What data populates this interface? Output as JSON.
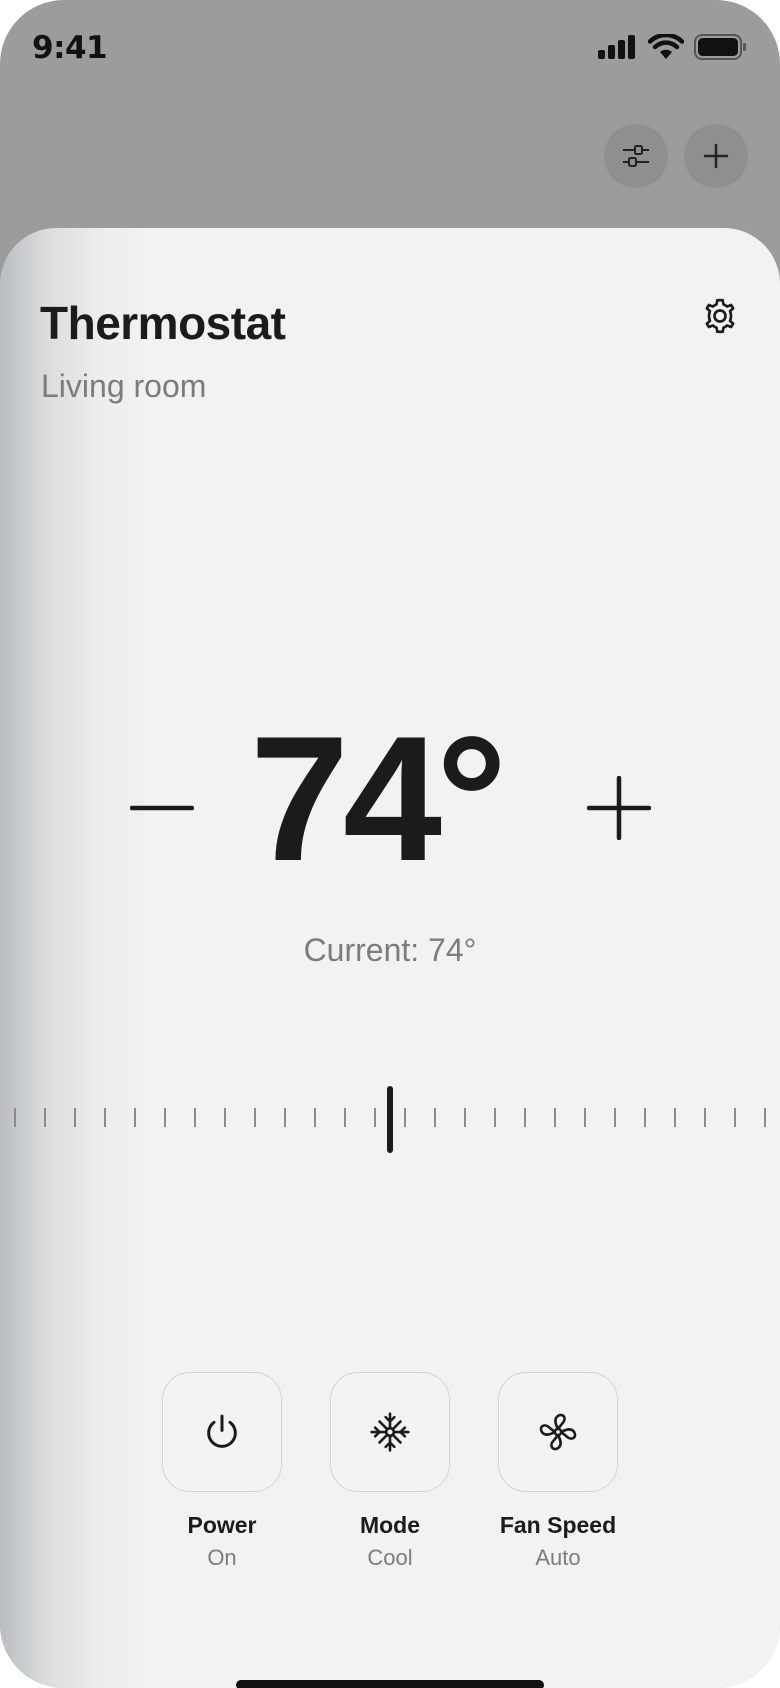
{
  "status_bar": {
    "time": "9:41",
    "icons": [
      "cellular-signal-icon",
      "wifi-icon",
      "battery-icon"
    ]
  },
  "top_actions": {
    "icons": [
      "sliders-icon",
      "plus-icon"
    ]
  },
  "thermostat": {
    "title": "Thermostat",
    "room": "Living room",
    "target_temp": "74°",
    "current_label": "Current: 74°",
    "target_value": 74,
    "current_value": 74
  },
  "controls": [
    {
      "label": "Power",
      "value": "On",
      "icon": "power-icon"
    },
    {
      "label": "Mode",
      "value": "Cool",
      "icon": "snowflake-icon"
    },
    {
      "label": "Fan Speed",
      "value": "Auto",
      "icon": "fan-icon"
    }
  ],
  "colors": {
    "text_primary": "#1b1b1b",
    "text_secondary": "#7c7c7c",
    "backdrop": "#9c9c9c",
    "sheet": "#f2f2f2"
  }
}
